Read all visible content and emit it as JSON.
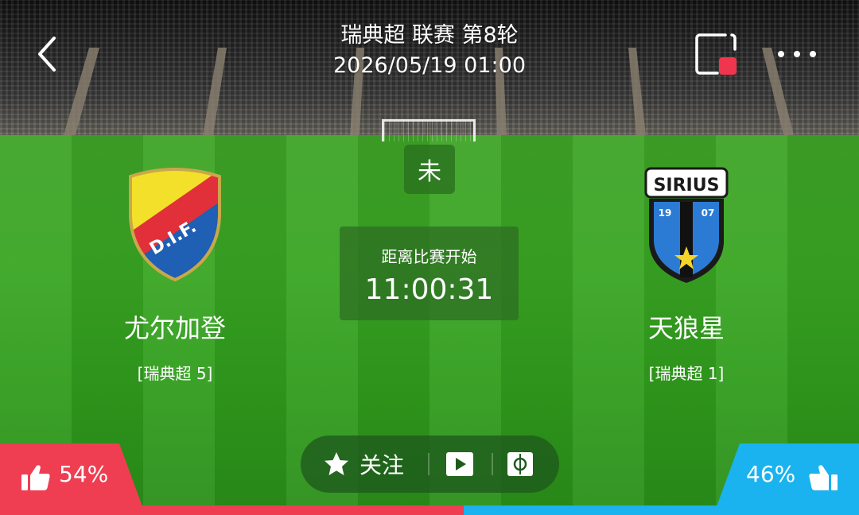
{
  "header": {
    "league_round": "瑞典超 联赛 第8轮",
    "datetime": "2026/05/19 01:00"
  },
  "match": {
    "status": "未",
    "countdown_label": "距离比赛开始",
    "countdown_time": "11:00:31"
  },
  "home": {
    "name": "尤尔加登",
    "league_rank": "[瑞典超 5]",
    "crest_text": "D.I.F."
  },
  "away": {
    "name": "天狼星",
    "league_rank": "[瑞典超 1]",
    "crest_text": "SIRIUS",
    "crest_year_left": "19",
    "crest_year_right": "07"
  },
  "actions": {
    "follow_label": "关注"
  },
  "votes": {
    "home_pct": "54%",
    "away_pct": "46%",
    "home_fraction": 0.54
  },
  "colors": {
    "home": "#ef3e52",
    "away": "#1ab2ef"
  },
  "icons": [
    "back-icon",
    "record-icon",
    "more-icon",
    "star-icon",
    "play-icon",
    "pitch-icon",
    "thumbs-up-icon"
  ]
}
